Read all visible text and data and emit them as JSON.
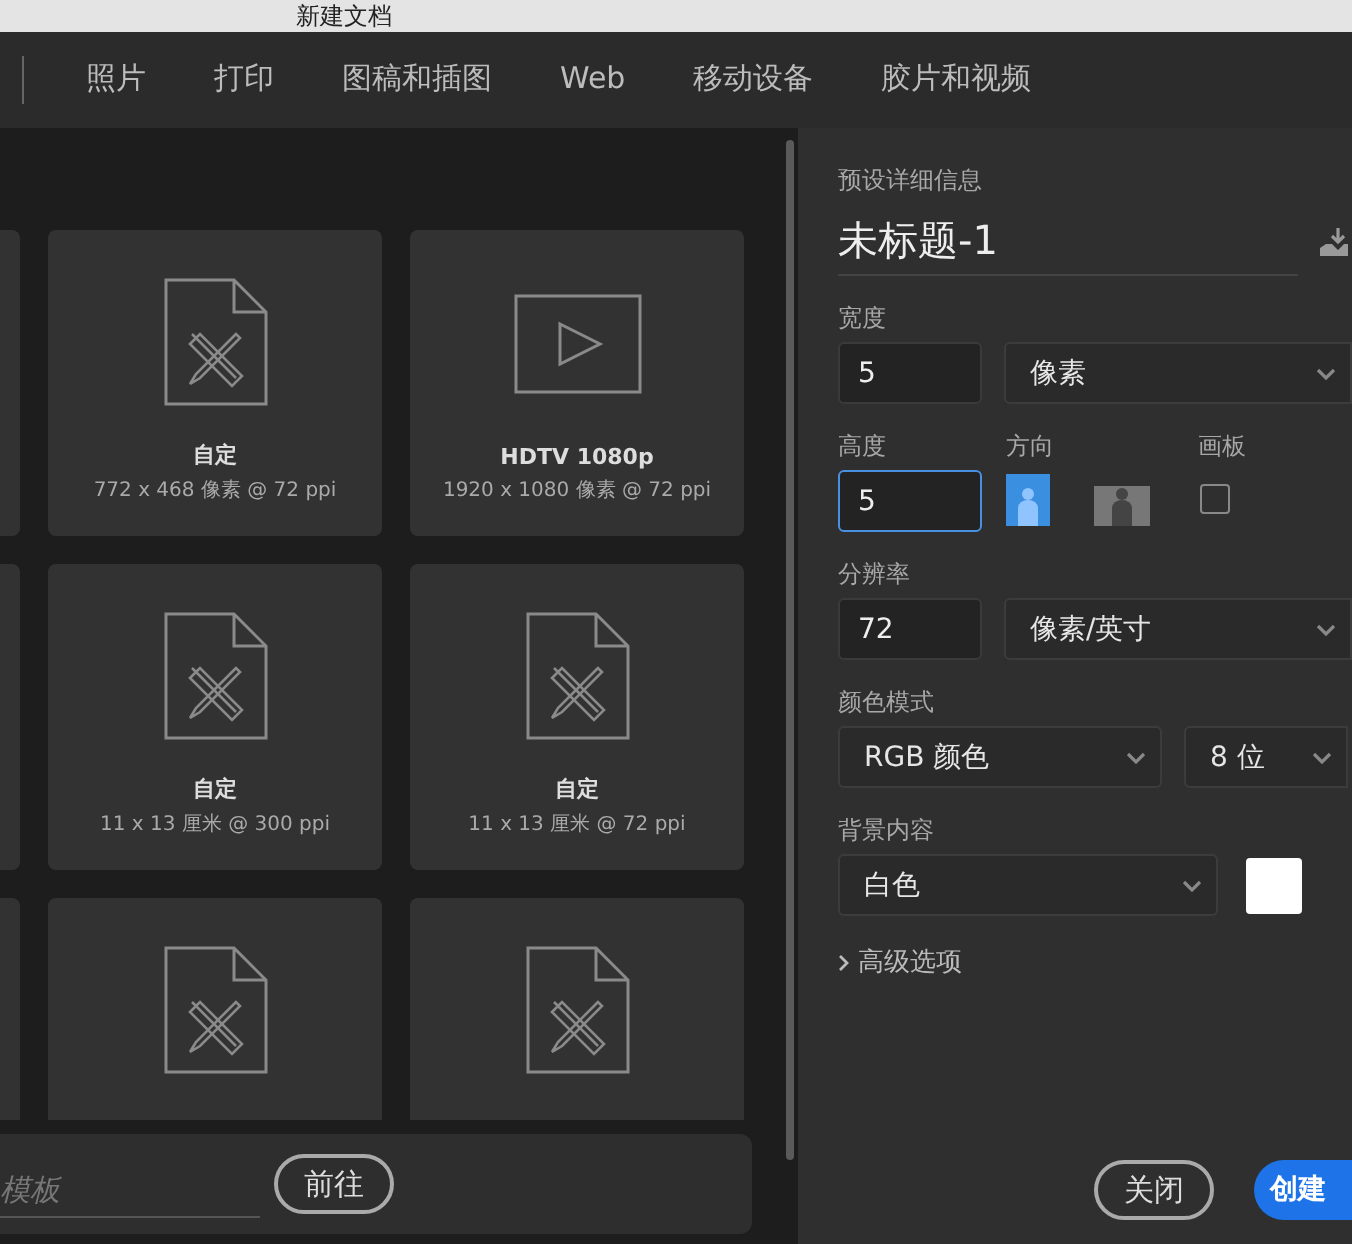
{
  "window": {
    "title": "新建文档"
  },
  "tabs": [
    {
      "label": "照片",
      "selected": false
    },
    {
      "label": "打印",
      "selected": false
    },
    {
      "label": "图稿和插图",
      "selected": false
    },
    {
      "label": "Web",
      "selected": false
    },
    {
      "label": "移动设备",
      "selected": false
    },
    {
      "label": "胶片和视频",
      "selected": false
    }
  ],
  "presets": [
    [
      {
        "kind": "document",
        "name": "自定",
        "size": "772 x 468 像素 @ 72 ppi"
      },
      {
        "kind": "video",
        "name": "HDTV 1080p",
        "size": "1920 x 1080 像素 @ 72 ppi"
      }
    ],
    [
      {
        "kind": "document",
        "name": "自定",
        "size": "11 x 13 厘米 @ 300 ppi"
      },
      {
        "kind": "document",
        "name": "自定",
        "size": "11 x 13 厘米 @ 72 ppi"
      }
    ],
    [
      {
        "kind": "document"
      },
      {
        "kind": "document"
      }
    ]
  ],
  "template_search": {
    "placeholder": "模板",
    "button": "前往"
  },
  "details": {
    "heading": "预设详细信息",
    "name": "未标题-1",
    "width": {
      "label": "宽度",
      "value": "5",
      "unit": "像素"
    },
    "height": {
      "label": "高度",
      "value": "5",
      "focused": true
    },
    "orientation": {
      "label": "方向",
      "options": [
        {
          "kind": "portrait",
          "selected": true
        },
        {
          "kind": "landscape",
          "selected": false
        }
      ]
    },
    "artboard": {
      "label": "画板",
      "checked": false
    },
    "resolution": {
      "label": "分辨率",
      "value": "72",
      "unit": "像素/英寸"
    },
    "color_mode": {
      "label": "颜色模式",
      "mode": "RGB 颜色",
      "depth": "8 位"
    },
    "background": {
      "label": "背景内容",
      "value": "白色",
      "color": "#ffffff"
    },
    "advanced": {
      "label": "高级选项",
      "expanded": false
    }
  },
  "buttons": {
    "close": "关闭",
    "create": "创建"
  }
}
